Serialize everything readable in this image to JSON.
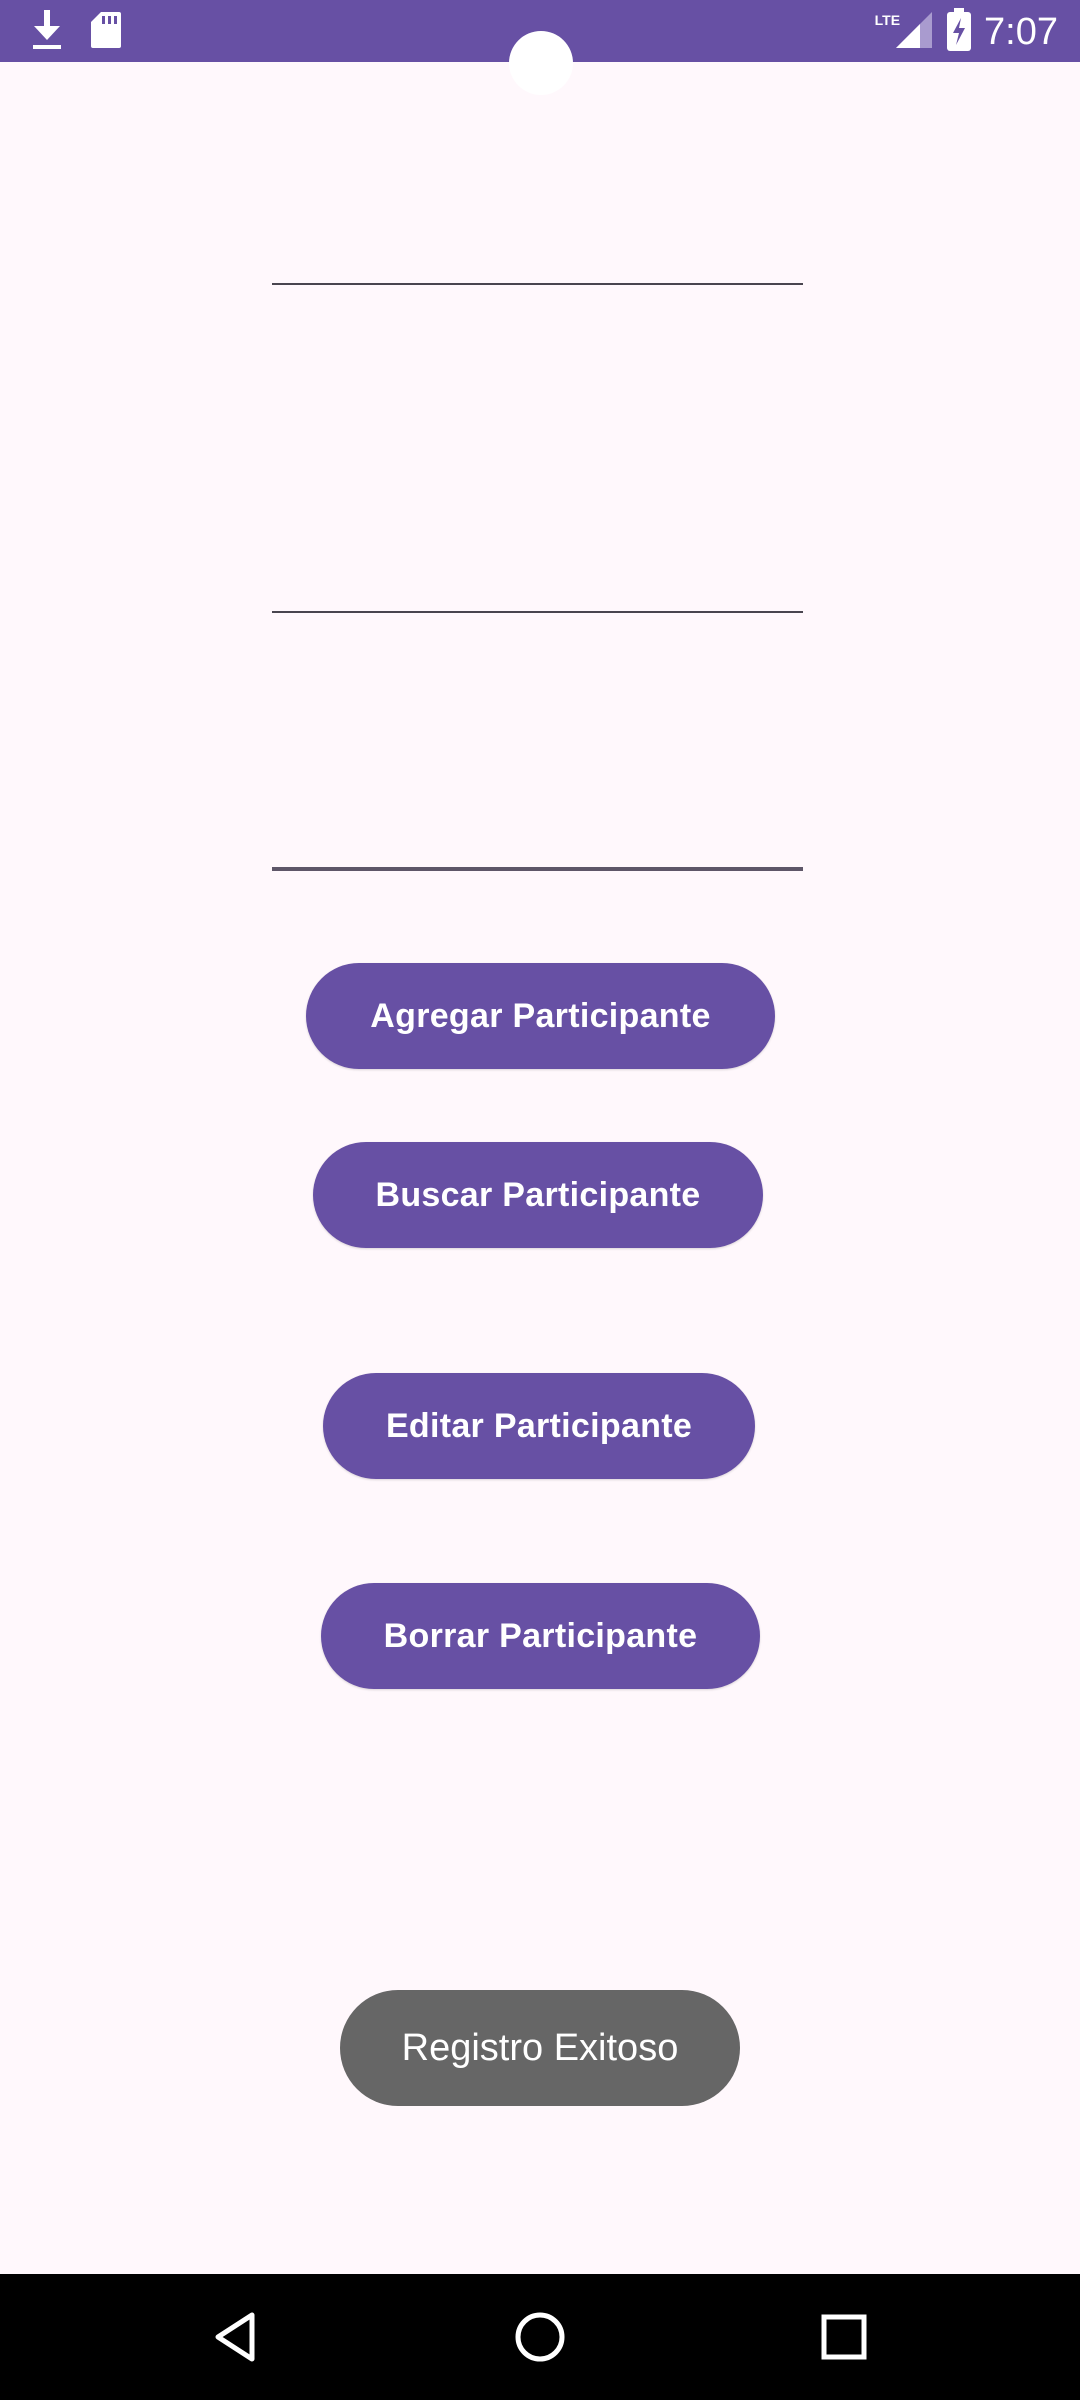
{
  "status_bar": {
    "time": "7:07",
    "network_label": "LTE",
    "background_color": "#6750A4",
    "icons": [
      "download-icon",
      "sd-card-icon",
      "signal-icon",
      "battery-charging-icon"
    ]
  },
  "form": {
    "fields": [
      {
        "value": "",
        "placeholder": ""
      },
      {
        "value": "",
        "placeholder": ""
      },
      {
        "value": "",
        "placeholder": ""
      }
    ]
  },
  "buttons": {
    "add": "Agregar Participante",
    "search": "Buscar Participante",
    "edit": "Editar Participante",
    "delete": "Borrar Participante"
  },
  "toast": {
    "message": "Registro Exitoso"
  },
  "nav_bar": {
    "icons": [
      "back-icon",
      "home-icon",
      "recents-icon"
    ]
  },
  "colors": {
    "primary": "#6750A4",
    "background": "#FFF8FC",
    "toast": "#666666"
  }
}
